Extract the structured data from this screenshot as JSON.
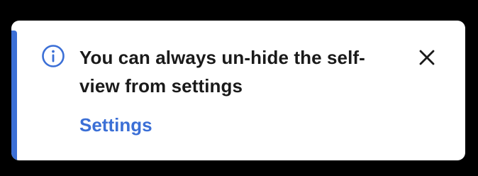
{
  "notification": {
    "message": "You can always un-hide the self-view from settings",
    "link_label": "Settings",
    "icons": {
      "info": "info-circle-icon",
      "close": "close-icon"
    },
    "colors": {
      "accent": "#3b6fd6",
      "background": "#ffffff",
      "text": "#1a1a1a"
    }
  }
}
